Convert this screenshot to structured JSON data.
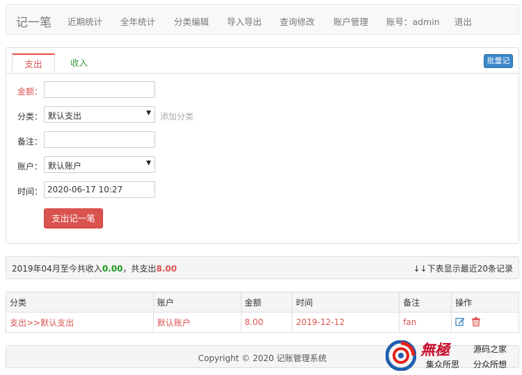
{
  "nav": {
    "brand": "记一笔",
    "items": [
      "近期统计",
      "全年统计",
      "分类编辑",
      "导入导出",
      "查询修改",
      "账户管理",
      "账号：admin",
      "退出"
    ]
  },
  "tabs": {
    "expense": "支出",
    "income": "收入",
    "batch_button": "批量记"
  },
  "form": {
    "amount_label": "金额：",
    "amount_value": "",
    "category_label": "分类：",
    "category_value": "默认支出",
    "add_category": "添加分类",
    "note_label": "备注：",
    "note_value": "",
    "account_label": "账户：",
    "account_value": "默认账户",
    "time_label": "时间：",
    "time_value": "2020-06-17 10:27",
    "submit_label": "支出记一笔"
  },
  "summary": {
    "prefix": "2019年04月至今共收入",
    "income": "0.00",
    "middle": "，共支出",
    "expense": "8.00",
    "note": "↓↓下表显示最近20条记录"
  },
  "table": {
    "headers": [
      "分类",
      "账户",
      "金额",
      "时间",
      "备注",
      "操作"
    ],
    "rows": [
      {
        "category": "支出>>默认支出",
        "account": "默认账户",
        "amount": "8.00",
        "time": "2019-12-12",
        "note": "fan"
      }
    ]
  },
  "footer": {
    "copyright": "Copyright © 2020 记账管理系统"
  },
  "watermark": {
    "big_text": "無極",
    "site": "源码之家",
    "slogan_left": "集众所思",
    "slogan_right": "分众所想"
  },
  "colors": {
    "expense_red": "#d9534f",
    "income_green": "#1a9a1a",
    "batch_blue": "#3a87c8"
  }
}
